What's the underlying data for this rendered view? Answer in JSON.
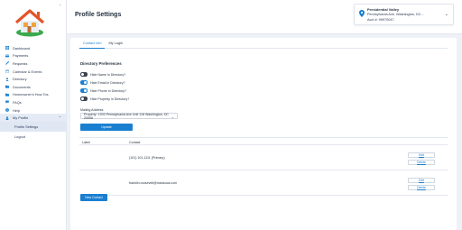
{
  "sidebar": {
    "items": [
      {
        "label": "Dashboard",
        "icon": "dashboard-icon"
      },
      {
        "label": "Payments",
        "icon": "payments-icon"
      },
      {
        "label": "Requests",
        "icon": "requests-icon"
      },
      {
        "label": "Calendar & Events",
        "icon": "calendar-icon"
      },
      {
        "label": "Directory",
        "icon": "directory-icon"
      },
      {
        "label": "Documents",
        "icon": "documents-icon"
      },
      {
        "label": "Homeowner's How Tos",
        "icon": "folder-icon"
      },
      {
        "label": "FAQs",
        "icon": "faq-icon"
      },
      {
        "label": "Help",
        "icon": "help-icon"
      },
      {
        "label": "My Profile",
        "icon": "profile-icon"
      }
    ],
    "sub_items": [
      {
        "label": "Profile Settings"
      },
      {
        "label": "Logout"
      }
    ]
  },
  "header": {
    "title": "Profile Settings",
    "property": {
      "name": "Presidential Valley",
      "address": "Pennsylvania Ave, Washington, DC...",
      "account": "Acct #: 99970047"
    }
  },
  "tabs": [
    {
      "label": "Contact Info"
    },
    {
      "label": "My Login"
    }
  ],
  "directory": {
    "title": "Directory Preferences",
    "toggles": [
      {
        "label": "Hide Name in Directory?",
        "on": false
      },
      {
        "label": "Hide Email in Directory?",
        "on": true
      },
      {
        "label": "Hide Phone in Directory?",
        "on": true
      },
      {
        "label": "Hide Property in Directory?",
        "on": false
      }
    ]
  },
  "mailing": {
    "label": "Mailing Address",
    "value": "Property: 1933 Pennsylvania Ave Unit 118 Washington, DC 20006"
  },
  "buttons": {
    "update": "Update",
    "new_contact": "New Contact",
    "edit": "Edit",
    "delete": "Delete"
  },
  "contacts": {
    "headers": [
      "Label",
      "Contact"
    ],
    "rows": [
      {
        "label": "",
        "contact": "(101) 101-1111 (Primary)"
      },
      {
        "label": "",
        "contact": "franklin.roosevelt@mansoca.com"
      }
    ]
  },
  "colors": {
    "accent": "#1a7fd1",
    "logo_roof": "#e2542b",
    "logo_green": "#3aa94e"
  }
}
